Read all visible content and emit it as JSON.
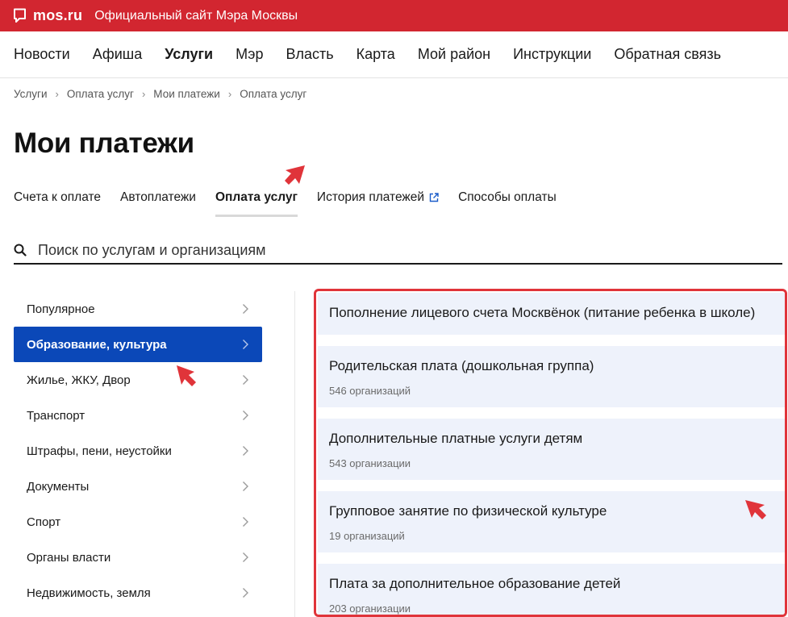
{
  "header": {
    "logo": "mos.ru",
    "site_title": "Официальный сайт Мэра Москвы"
  },
  "nav": [
    {
      "label": "Новости"
    },
    {
      "label": "Афиша"
    },
    {
      "label": "Услуги",
      "active": true
    },
    {
      "label": "Мэр"
    },
    {
      "label": "Власть"
    },
    {
      "label": "Карта"
    },
    {
      "label": "Мой район"
    },
    {
      "label": "Инструкции"
    },
    {
      "label": "Обратная связь"
    }
  ],
  "breadcrumb": [
    "Услуги",
    "Оплата услуг",
    "Мои платежи",
    "Оплата услуг"
  ],
  "page_title": "Мои платежи",
  "tabs": [
    {
      "label": "Счета к оплате"
    },
    {
      "label": "Автоплатежи"
    },
    {
      "label": "Оплата услуг",
      "active": true
    },
    {
      "label": "История платежей",
      "external": true
    },
    {
      "label": "Способы оплаты"
    }
  ],
  "search": {
    "placeholder": "Поиск по услугам и организациям"
  },
  "categories": [
    {
      "label": "Популярное"
    },
    {
      "label": "Образование, культура",
      "active": true
    },
    {
      "label": "Жилье, ЖКУ, Двор"
    },
    {
      "label": "Транспорт"
    },
    {
      "label": "Штрафы, пени, неустойки"
    },
    {
      "label": "Документы"
    },
    {
      "label": "Спорт"
    },
    {
      "label": "Органы власти"
    },
    {
      "label": "Недвижимость, земля"
    }
  ],
  "services": [
    {
      "title": "Пополнение лицевого счета Москвёнок (питание ребенка в школе)",
      "count": ""
    },
    {
      "title": "Родительская плата (дошкольная группа)",
      "count": "546 организаций"
    },
    {
      "title": "Дополнительные платные услуги детям",
      "count": "543 организации"
    },
    {
      "title": "Групповое занятие по физической культуре",
      "count": "19 организаций"
    },
    {
      "title": "Плата за дополнительное образование детей",
      "count": "203 организации"
    }
  ],
  "colors": {
    "brand_red": "#d22630",
    "active_blue": "#0b48b8",
    "card_bg": "#eef2fb",
    "highlight_red": "#e0343a"
  }
}
